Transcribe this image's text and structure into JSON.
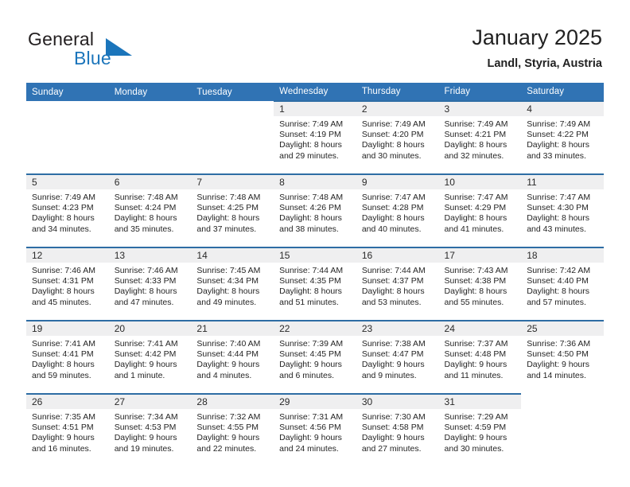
{
  "brand": {
    "word_one": "General",
    "word_two": "Blue",
    "triangle_icon": "triangle-logo-icon",
    "accent_color": "#1b75bb"
  },
  "header": {
    "title": "January 2025",
    "location": "Landl, Styria, Austria"
  },
  "theme": {
    "header_bg": "#3073b4",
    "header_text": "#ffffff",
    "row_divider": "#2e6da4",
    "daynum_band_bg": "#efeff0",
    "cell_bg": "#ffffff"
  },
  "weekday_headers": [
    "Sunday",
    "Monday",
    "Tuesday",
    "Wednesday",
    "Thursday",
    "Friday",
    "Saturday"
  ],
  "weeks": [
    [
      {
        "empty": true
      },
      {
        "empty": true
      },
      {
        "empty": true
      },
      {
        "day": "1",
        "sunrise": "Sunrise: 7:49 AM",
        "sunset": "Sunset: 4:19 PM",
        "daylight": "Daylight: 8 hours and 29 minutes."
      },
      {
        "day": "2",
        "sunrise": "Sunrise: 7:49 AM",
        "sunset": "Sunset: 4:20 PM",
        "daylight": "Daylight: 8 hours and 30 minutes."
      },
      {
        "day": "3",
        "sunrise": "Sunrise: 7:49 AM",
        "sunset": "Sunset: 4:21 PM",
        "daylight": "Daylight: 8 hours and 32 minutes."
      },
      {
        "day": "4",
        "sunrise": "Sunrise: 7:49 AM",
        "sunset": "Sunset: 4:22 PM",
        "daylight": "Daylight: 8 hours and 33 minutes."
      }
    ],
    [
      {
        "day": "5",
        "sunrise": "Sunrise: 7:49 AM",
        "sunset": "Sunset: 4:23 PM",
        "daylight": "Daylight: 8 hours and 34 minutes."
      },
      {
        "day": "6",
        "sunrise": "Sunrise: 7:48 AM",
        "sunset": "Sunset: 4:24 PM",
        "daylight": "Daylight: 8 hours and 35 minutes."
      },
      {
        "day": "7",
        "sunrise": "Sunrise: 7:48 AM",
        "sunset": "Sunset: 4:25 PM",
        "daylight": "Daylight: 8 hours and 37 minutes."
      },
      {
        "day": "8",
        "sunrise": "Sunrise: 7:48 AM",
        "sunset": "Sunset: 4:26 PM",
        "daylight": "Daylight: 8 hours and 38 minutes."
      },
      {
        "day": "9",
        "sunrise": "Sunrise: 7:47 AM",
        "sunset": "Sunset: 4:28 PM",
        "daylight": "Daylight: 8 hours and 40 minutes."
      },
      {
        "day": "10",
        "sunrise": "Sunrise: 7:47 AM",
        "sunset": "Sunset: 4:29 PM",
        "daylight": "Daylight: 8 hours and 41 minutes."
      },
      {
        "day": "11",
        "sunrise": "Sunrise: 7:47 AM",
        "sunset": "Sunset: 4:30 PM",
        "daylight": "Daylight: 8 hours and 43 minutes."
      }
    ],
    [
      {
        "day": "12",
        "sunrise": "Sunrise: 7:46 AM",
        "sunset": "Sunset: 4:31 PM",
        "daylight": "Daylight: 8 hours and 45 minutes."
      },
      {
        "day": "13",
        "sunrise": "Sunrise: 7:46 AM",
        "sunset": "Sunset: 4:33 PM",
        "daylight": "Daylight: 8 hours and 47 minutes."
      },
      {
        "day": "14",
        "sunrise": "Sunrise: 7:45 AM",
        "sunset": "Sunset: 4:34 PM",
        "daylight": "Daylight: 8 hours and 49 minutes."
      },
      {
        "day": "15",
        "sunrise": "Sunrise: 7:44 AM",
        "sunset": "Sunset: 4:35 PM",
        "daylight": "Daylight: 8 hours and 51 minutes."
      },
      {
        "day": "16",
        "sunrise": "Sunrise: 7:44 AM",
        "sunset": "Sunset: 4:37 PM",
        "daylight": "Daylight: 8 hours and 53 minutes."
      },
      {
        "day": "17",
        "sunrise": "Sunrise: 7:43 AM",
        "sunset": "Sunset: 4:38 PM",
        "daylight": "Daylight: 8 hours and 55 minutes."
      },
      {
        "day": "18",
        "sunrise": "Sunrise: 7:42 AM",
        "sunset": "Sunset: 4:40 PM",
        "daylight": "Daylight: 8 hours and 57 minutes."
      }
    ],
    [
      {
        "day": "19",
        "sunrise": "Sunrise: 7:41 AM",
        "sunset": "Sunset: 4:41 PM",
        "daylight": "Daylight: 8 hours and 59 minutes."
      },
      {
        "day": "20",
        "sunrise": "Sunrise: 7:41 AM",
        "sunset": "Sunset: 4:42 PM",
        "daylight": "Daylight: 9 hours and 1 minute."
      },
      {
        "day": "21",
        "sunrise": "Sunrise: 7:40 AM",
        "sunset": "Sunset: 4:44 PM",
        "daylight": "Daylight: 9 hours and 4 minutes."
      },
      {
        "day": "22",
        "sunrise": "Sunrise: 7:39 AM",
        "sunset": "Sunset: 4:45 PM",
        "daylight": "Daylight: 9 hours and 6 minutes."
      },
      {
        "day": "23",
        "sunrise": "Sunrise: 7:38 AM",
        "sunset": "Sunset: 4:47 PM",
        "daylight": "Daylight: 9 hours and 9 minutes."
      },
      {
        "day": "24",
        "sunrise": "Sunrise: 7:37 AM",
        "sunset": "Sunset: 4:48 PM",
        "daylight": "Daylight: 9 hours and 11 minutes."
      },
      {
        "day": "25",
        "sunrise": "Sunrise: 7:36 AM",
        "sunset": "Sunset: 4:50 PM",
        "daylight": "Daylight: 9 hours and 14 minutes."
      }
    ],
    [
      {
        "day": "26",
        "sunrise": "Sunrise: 7:35 AM",
        "sunset": "Sunset: 4:51 PM",
        "daylight": "Daylight: 9 hours and 16 minutes."
      },
      {
        "day": "27",
        "sunrise": "Sunrise: 7:34 AM",
        "sunset": "Sunset: 4:53 PM",
        "daylight": "Daylight: 9 hours and 19 minutes."
      },
      {
        "day": "28",
        "sunrise": "Sunrise: 7:32 AM",
        "sunset": "Sunset: 4:55 PM",
        "daylight": "Daylight: 9 hours and 22 minutes."
      },
      {
        "day": "29",
        "sunrise": "Sunrise: 7:31 AM",
        "sunset": "Sunset: 4:56 PM",
        "daylight": "Daylight: 9 hours and 24 minutes."
      },
      {
        "day": "30",
        "sunrise": "Sunrise: 7:30 AM",
        "sunset": "Sunset: 4:58 PM",
        "daylight": "Daylight: 9 hours and 27 minutes."
      },
      {
        "day": "31",
        "sunrise": "Sunrise: 7:29 AM",
        "sunset": "Sunset: 4:59 PM",
        "daylight": "Daylight: 9 hours and 30 minutes."
      },
      {
        "empty": true
      }
    ]
  ]
}
